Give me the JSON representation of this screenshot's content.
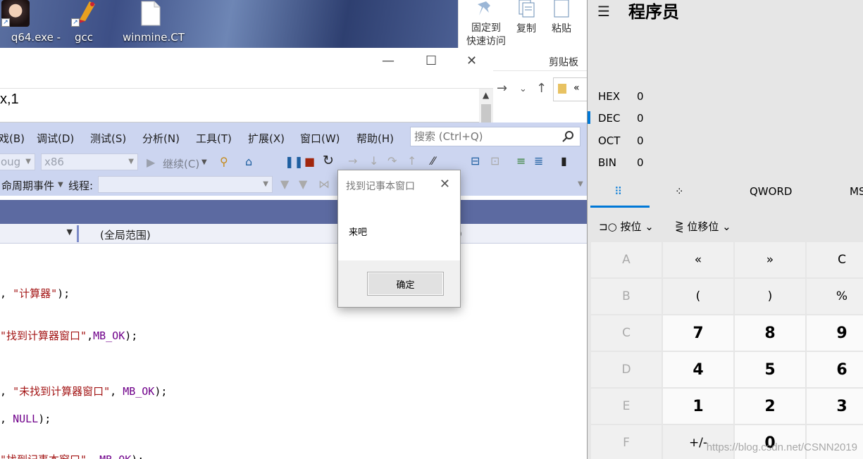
{
  "desktop": {
    "icons": [
      {
        "label": "q64.exe -"
      },
      {
        "label": "gcc"
      },
      {
        "label": "winmine.CT"
      }
    ]
  },
  "explorer": {
    "pin_label_1": "固定到",
    "pin_label_2": "快速访问",
    "copy_label": "复制",
    "paste_label": "粘贴",
    "clipboard_group": "剪贴板",
    "addr_text": "«"
  },
  "notepad": {
    "text": "x,1"
  },
  "vs": {
    "menu": [
      "戏(B)",
      "调试(D)",
      "测试(S)",
      "分析(N)",
      "工具(T)",
      "扩展(X)",
      "窗口(W)",
      "帮助(H)"
    ],
    "search_placeholder": "搜索 (Ctrl+Q)",
    "config_combo": "oug",
    "platform_combo": "x86",
    "continue_label": "继续(C)",
    "lifecycle_label": "命周期事件",
    "thread_label": "线程:",
    "scope_label": "(全局范围)",
    "scope2_label": ")",
    "code": {
      "l1_pre": ", ",
      "l1_str": "\"计算器\"",
      "l1_post": ");",
      "l2_str": "\"找到计算器窗口\"",
      "l2_sep": ",",
      "l2_mac": "MB_OK",
      "l2_post": ");",
      "l3_pre": ", ",
      "l3_str": "\"未找到计算器窗口\"",
      "l3_sep": ", ",
      "l3_mac": "MB_OK",
      "l3_post": ");",
      "l4_pre": ", ",
      "l4_mac": "NULL",
      "l4_post": ");",
      "l5_str": "\"找到记事本窗口\"",
      "l5_sep": ", ",
      "l5_mac": "MB_OK",
      "l5_post": ");"
    }
  },
  "msgbox": {
    "title": "找到记事本窗口",
    "message": "来吧",
    "ok_label": "确定"
  },
  "calc": {
    "title": "程序员",
    "radix": [
      {
        "name": "HEX",
        "value": "0"
      },
      {
        "name": "DEC",
        "value": "0"
      },
      {
        "name": "OCT",
        "value": "0"
      },
      {
        "name": "BIN",
        "value": "0"
      }
    ],
    "word_size": "QWORD",
    "ms_label": "MS",
    "bitwise_label": "按位",
    "bitshift_label": "位移位",
    "keys": [
      [
        "A",
        "«",
        "»",
        "C"
      ],
      [
        "B",
        "(",
        ")",
        "%"
      ],
      [
        "C",
        "7",
        "8",
        "9"
      ],
      [
        "D",
        "4",
        "5",
        "6"
      ],
      [
        "E",
        "1",
        "2",
        "3"
      ],
      [
        "F",
        "+/-",
        "0",
        ""
      ]
    ],
    "watermark": "https://blog.csdn.net/CSNN2019"
  },
  "colors": {
    "accent": "#0078d7",
    "vs_menu": "#ccd5f0",
    "vs_band": "#5c6aa1",
    "string": "#a31515",
    "macro": "#6f008a"
  }
}
